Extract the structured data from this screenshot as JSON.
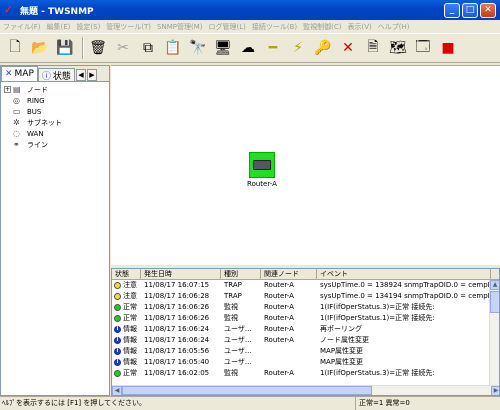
{
  "window": {
    "title": "無題 - TWSNMP",
    "min": "_",
    "max": "□",
    "close": "✕"
  },
  "menu": [
    "ファイル(F)",
    "編集(E)",
    "設定(S)",
    "管理ツール(T)",
    "SNMP管理(M)",
    "ログ管理(L)",
    "接続ツール(B)",
    "監視制御(C)",
    "表示(V)",
    "ヘルプ(H)"
  ],
  "toolbar_icons": [
    "new-icon",
    "open-icon",
    "save-icon",
    "delete-icon",
    "cut-icon",
    "copy-icon",
    "paste-icon",
    "find-icon",
    "add-node-icon",
    "add-network-icon",
    "add-line-icon",
    "connect-icon",
    "key-icon",
    "cancel-icon",
    "log-icon",
    "map-icon",
    "prop-icon",
    "stop-icon"
  ],
  "tabs": {
    "map": "MAP",
    "status": "状態"
  },
  "tree": [
    {
      "label": "ノード",
      "icon": "node-icon"
    },
    {
      "label": "RING",
      "icon": "ring-icon"
    },
    {
      "label": "BUS",
      "icon": "bus-icon"
    },
    {
      "label": "サブネット",
      "icon": "subnet-icon"
    },
    {
      "label": "WAN",
      "icon": "wan-icon"
    },
    {
      "label": "ライン",
      "icon": "line-icon"
    }
  ],
  "map": {
    "node_label": "Router-A"
  },
  "table": {
    "headers": [
      "状態",
      "発生日時",
      "種別",
      "関連ノード",
      "イベント"
    ],
    "rows": [
      {
        "status": "注意",
        "icon": "warn",
        "time": "11/08/17 16:07:15",
        "type": "TRAP",
        "node": "Router-A",
        "event": "sysUpTime.0 = 138924 snmpTrapOID.0 = cempM"
      },
      {
        "status": "注意",
        "icon": "warn",
        "time": "11/08/17 16:06:28",
        "type": "TRAP",
        "node": "Router-A",
        "event": "sysUpTime.0 = 134194 snmpTrapOID.0 = cempM"
      },
      {
        "status": "正常",
        "icon": "ok",
        "time": "11/08/17 16:06:26",
        "type": "監視",
        "node": "Router-A",
        "event": "1(IF(ifOperStatus.3)=正常 接続先:"
      },
      {
        "status": "正常",
        "icon": "ok",
        "time": "11/08/17 16:06:26",
        "type": "監視",
        "node": "Router-A",
        "event": "1(IF(ifOperStatus.1)=正常 接続先:"
      },
      {
        "status": "情報",
        "icon": "info",
        "time": "11/08/17 16:06:24",
        "type": "ユーザ...",
        "node": "Router-A",
        "event": "再ポーリング"
      },
      {
        "status": "情報",
        "icon": "info",
        "time": "11/08/17 16:06:24",
        "type": "ユーザ...",
        "node": "Router-A",
        "event": "ノード属性変更"
      },
      {
        "status": "情報",
        "icon": "info",
        "time": "11/08/17 16:05:56",
        "type": "ユーザ...",
        "node": "",
        "event": "MAP属性変更"
      },
      {
        "status": "情報",
        "icon": "info",
        "time": "11/08/17 16:05:40",
        "type": "ユーザ...",
        "node": "",
        "event": "MAP属性変更"
      },
      {
        "status": "正常",
        "icon": "ok",
        "time": "11/08/17 16:02:05",
        "type": "監視",
        "node": "Router-A",
        "event": "1(IF(ifOperStatus.3)=正常 接続先:"
      }
    ]
  },
  "status": {
    "message": "ﾍﾙﾌﾟを表示するには [F1] を押してください。",
    "counts": "正常=1 異常=0"
  },
  "colors": {
    "warn": "#F2E12A",
    "ok": "#22CC22",
    "info": "#1A3FD0",
    "node_bg": "#22DD22"
  }
}
